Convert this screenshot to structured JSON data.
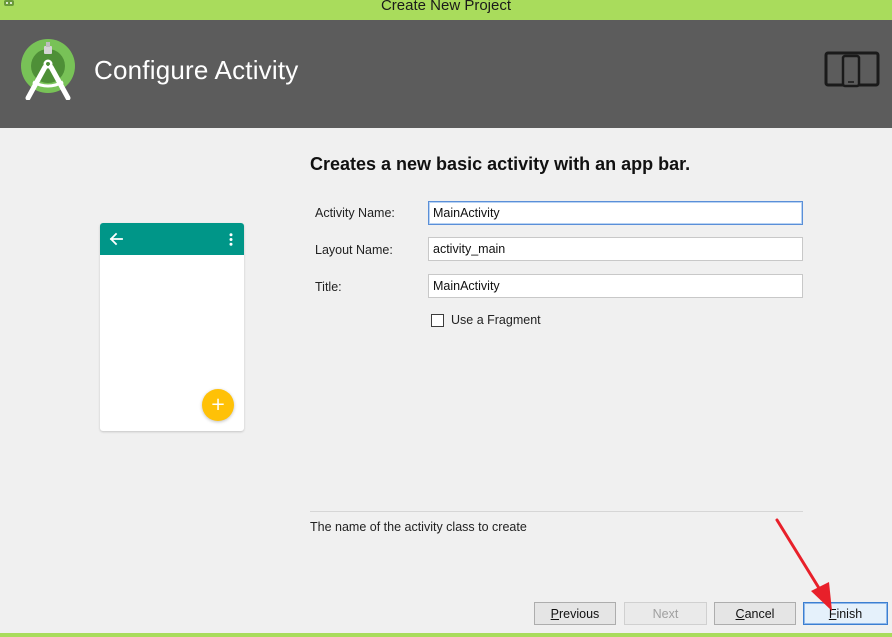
{
  "window": {
    "title": "Create New Project"
  },
  "header": {
    "heading": "Configure Activity",
    "logo_icon": "android-studio-logo-icon",
    "devices_icon": "phone-tablet-devices-icon"
  },
  "preview": {
    "appbar_color": "#009688",
    "fab_color": "#ffc107",
    "fab_glyph": "+",
    "back_icon": "arrow-back-icon",
    "overflow_icon": "more-vert-icon"
  },
  "form": {
    "heading": "Creates a new basic activity with an app bar.",
    "fields": [
      {
        "label": "Activity Name:",
        "value": "MainActivity"
      },
      {
        "label": "Layout Name:",
        "value": "activity_main"
      },
      {
        "label": "Title:",
        "value": "MainActivity"
      }
    ],
    "fragment_checkbox": {
      "label": "Use a Fragment",
      "checked": false
    },
    "hint": "The name of the activity class to create"
  },
  "buttons": {
    "previous": {
      "mnemonic": "P",
      "rest": "revious"
    },
    "next": {
      "label": "Next"
    },
    "cancel": {
      "mnemonic": "C",
      "rest": "ancel"
    },
    "finish": {
      "mnemonic": "F",
      "rest": "inish"
    }
  },
  "colors": {
    "titlebar": "#a9dc5c",
    "header": "#5c5c5c",
    "annotation_arrow": "#e8202a"
  }
}
